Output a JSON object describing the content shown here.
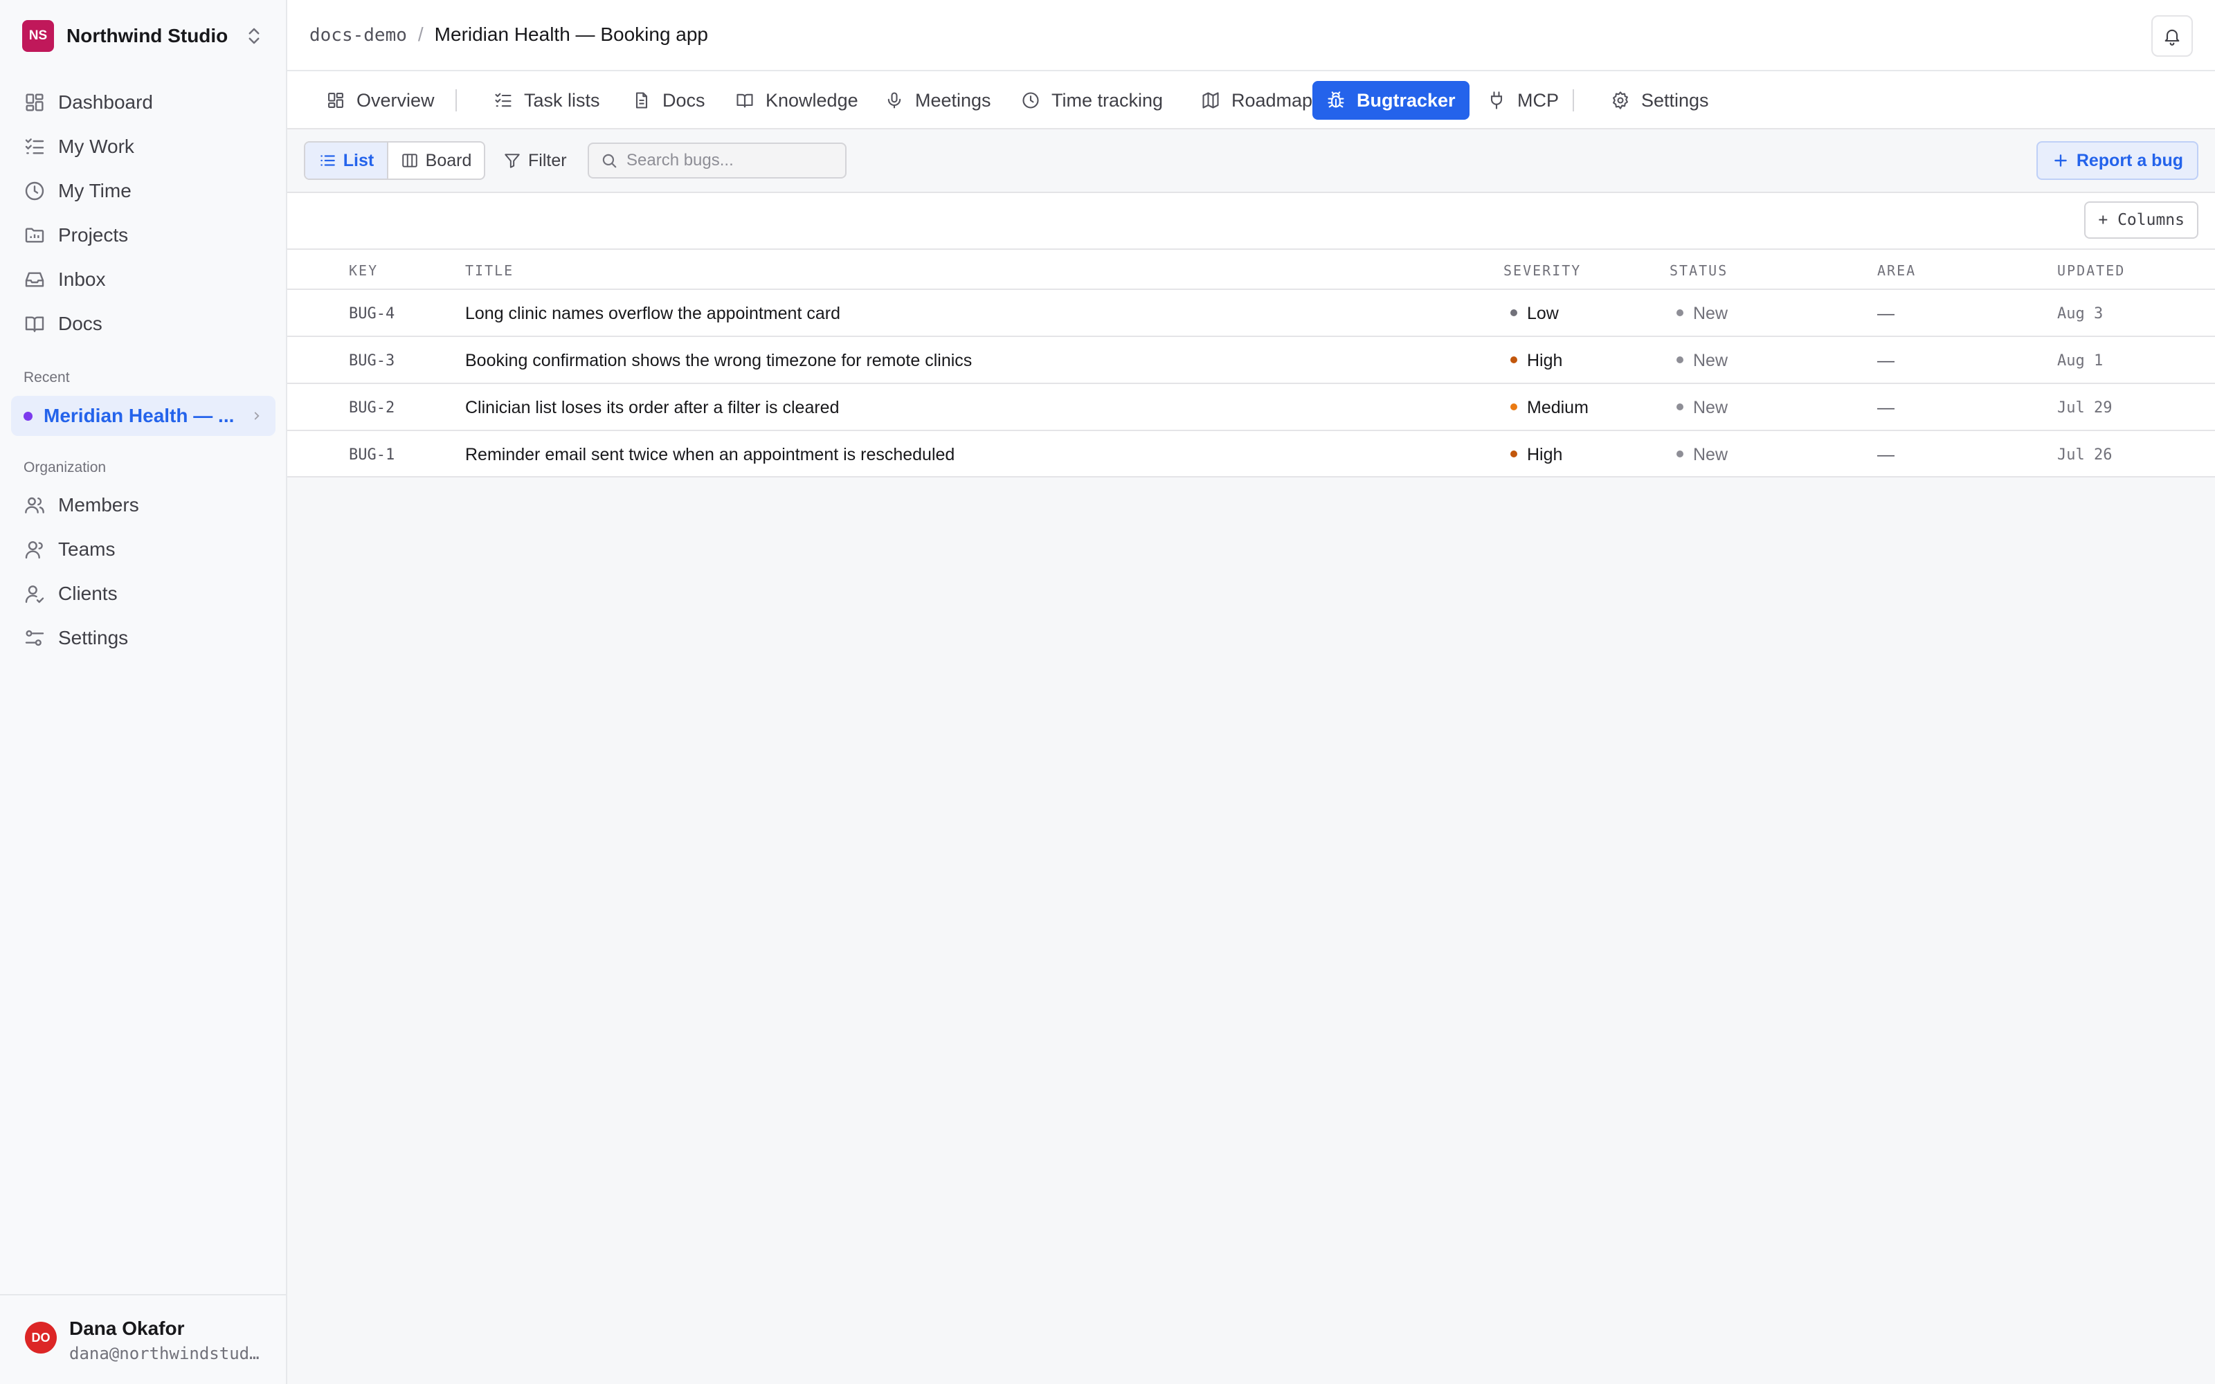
{
  "workspace": {
    "initials": "NS",
    "name": "Northwind Studio",
    "brand_color": "#c0185a"
  },
  "sidebar": {
    "items": [
      {
        "label": "Dashboard",
        "icon": "dashboard-icon"
      },
      {
        "label": "My Work",
        "icon": "checklist-icon"
      },
      {
        "label": "My Time",
        "icon": "clock-icon"
      },
      {
        "label": "Projects",
        "icon": "folder-icon"
      },
      {
        "label": "Inbox",
        "icon": "inbox-icon"
      },
      {
        "label": "Docs",
        "icon": "book-icon"
      }
    ],
    "recent_label": "Recent",
    "recent_item": "Meridian Health — Booking app",
    "recent_item_display": "Meridian Health — ...",
    "org_label": "Organization",
    "org_items": [
      {
        "label": "Members",
        "icon": "members-icon"
      },
      {
        "label": "Teams",
        "icon": "teams-icon"
      },
      {
        "label": "Clients",
        "icon": "client-icon"
      },
      {
        "label": "Settings",
        "icon": "settings-sliders-icon"
      }
    ]
  },
  "user": {
    "initials": "DO",
    "name": "Dana Okafor",
    "email": "dana@northwindstudio.com",
    "email_display": "dana@northwindstud…"
  },
  "breadcrumb": {
    "org": "docs-demo",
    "separator": "/",
    "project": "Meridian Health — Booking app"
  },
  "tabs": [
    {
      "label": "Overview",
      "icon": "overview-icon"
    },
    {
      "label": "Task lists",
      "icon": "checklist-icon"
    },
    {
      "label": "Docs",
      "icon": "document-icon"
    },
    {
      "label": "Knowledge",
      "icon": "book-icon"
    },
    {
      "label": "Meetings",
      "icon": "microphone-icon"
    },
    {
      "label": "Time tracking",
      "icon": "clock-icon"
    },
    {
      "label": "Roadmap",
      "icon": "map-icon"
    },
    {
      "label": "Bugtracker",
      "icon": "bug-icon",
      "active": true
    },
    {
      "label": "MCP",
      "icon": "plug-icon"
    },
    {
      "label": "Settings",
      "icon": "gear-icon"
    }
  ],
  "toolbar": {
    "view_list": "List",
    "view_board": "Board",
    "filter": "Filter",
    "search_placeholder": "Search bugs...",
    "report_button": "Report a bug"
  },
  "table": {
    "columns_button": "+ Columns",
    "headers": {
      "key": "KEY",
      "title": "TITLE",
      "severity": "SEVERITY",
      "status": "STATUS",
      "area": "AREA",
      "updated": "UPDATED"
    },
    "rows": [
      {
        "key": "BUG-4",
        "title": "Long clinic names overflow the appointment card",
        "severity": "Low",
        "status": "New",
        "area": "—",
        "updated": "Aug 3"
      },
      {
        "key": "BUG-3",
        "title": "Booking confirmation shows the wrong timezone for remote clinics",
        "severity": "High",
        "status": "New",
        "area": "—",
        "updated": "Aug 1"
      },
      {
        "key": "BUG-2",
        "title": "Clinician list loses its order after a filter is cleared",
        "severity": "Medium",
        "status": "New",
        "area": "—",
        "updated": "Jul 29"
      },
      {
        "key": "BUG-1",
        "title": "Reminder email sent twice when an appointment is rescheduled",
        "severity": "High",
        "status": "New",
        "area": "—",
        "updated": "Jul 26"
      }
    ]
  },
  "colors": {
    "accent": "#2463eb",
    "severity_low": "#71717a",
    "severity_high": "#c2570c",
    "severity_medium": "#ea7a12",
    "status_new": "#8e8e96"
  }
}
